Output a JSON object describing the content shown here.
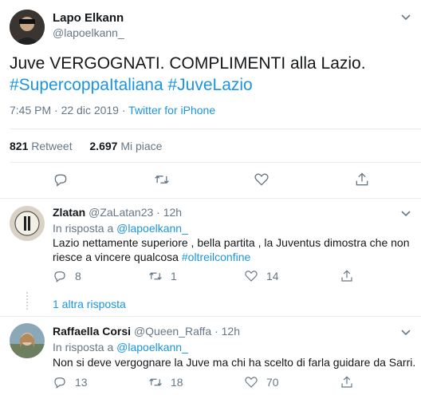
{
  "main_tweet": {
    "author_name": "Lapo Elkann",
    "handle": "@lapoelkann_",
    "text_line1": "Juve VERGOGNATI. COMPLIMENTI alla Lazio.",
    "hashtag1": "#SupercoppaItaliana",
    "hashtag2": "#JuveLazio",
    "timestamp": "7:45 PM · 22 dic 2019 · ",
    "source": "Twitter for iPhone",
    "retweet_count": "821",
    "retweet_label": "Retweet",
    "like_count": "2.697",
    "like_label": "Mi piace"
  },
  "replies": [
    {
      "author_name": "Zlatan",
      "handle": "@ZaLatan23",
      "time": "· 12h",
      "reply_prefix": "In risposta a",
      "reply_to": "@lapoelkann_",
      "text_line1": "Lazio nettamente superiore , bella partita , la Juventus dimostra che non",
      "text_line2": "riesce a vincere qualcosa",
      "hashtag": "#oltreilconfine",
      "reply_count": "8",
      "retweet_count": "1",
      "like_count": "14"
    },
    {
      "author_name": "Raffaella Corsi",
      "handle": "@Queen_Raffa",
      "time": "· 12h",
      "reply_prefix": "In risposta a",
      "reply_to": "@lapoelkann_",
      "text_line1": "Non si deve vergognare la Juve ma chi ha scelto di farla guidare da Sarri.",
      "reply_count": "13",
      "retweet_count": "18",
      "like_count": "70"
    }
  ],
  "more_replies_label": "1 altra risposta"
}
